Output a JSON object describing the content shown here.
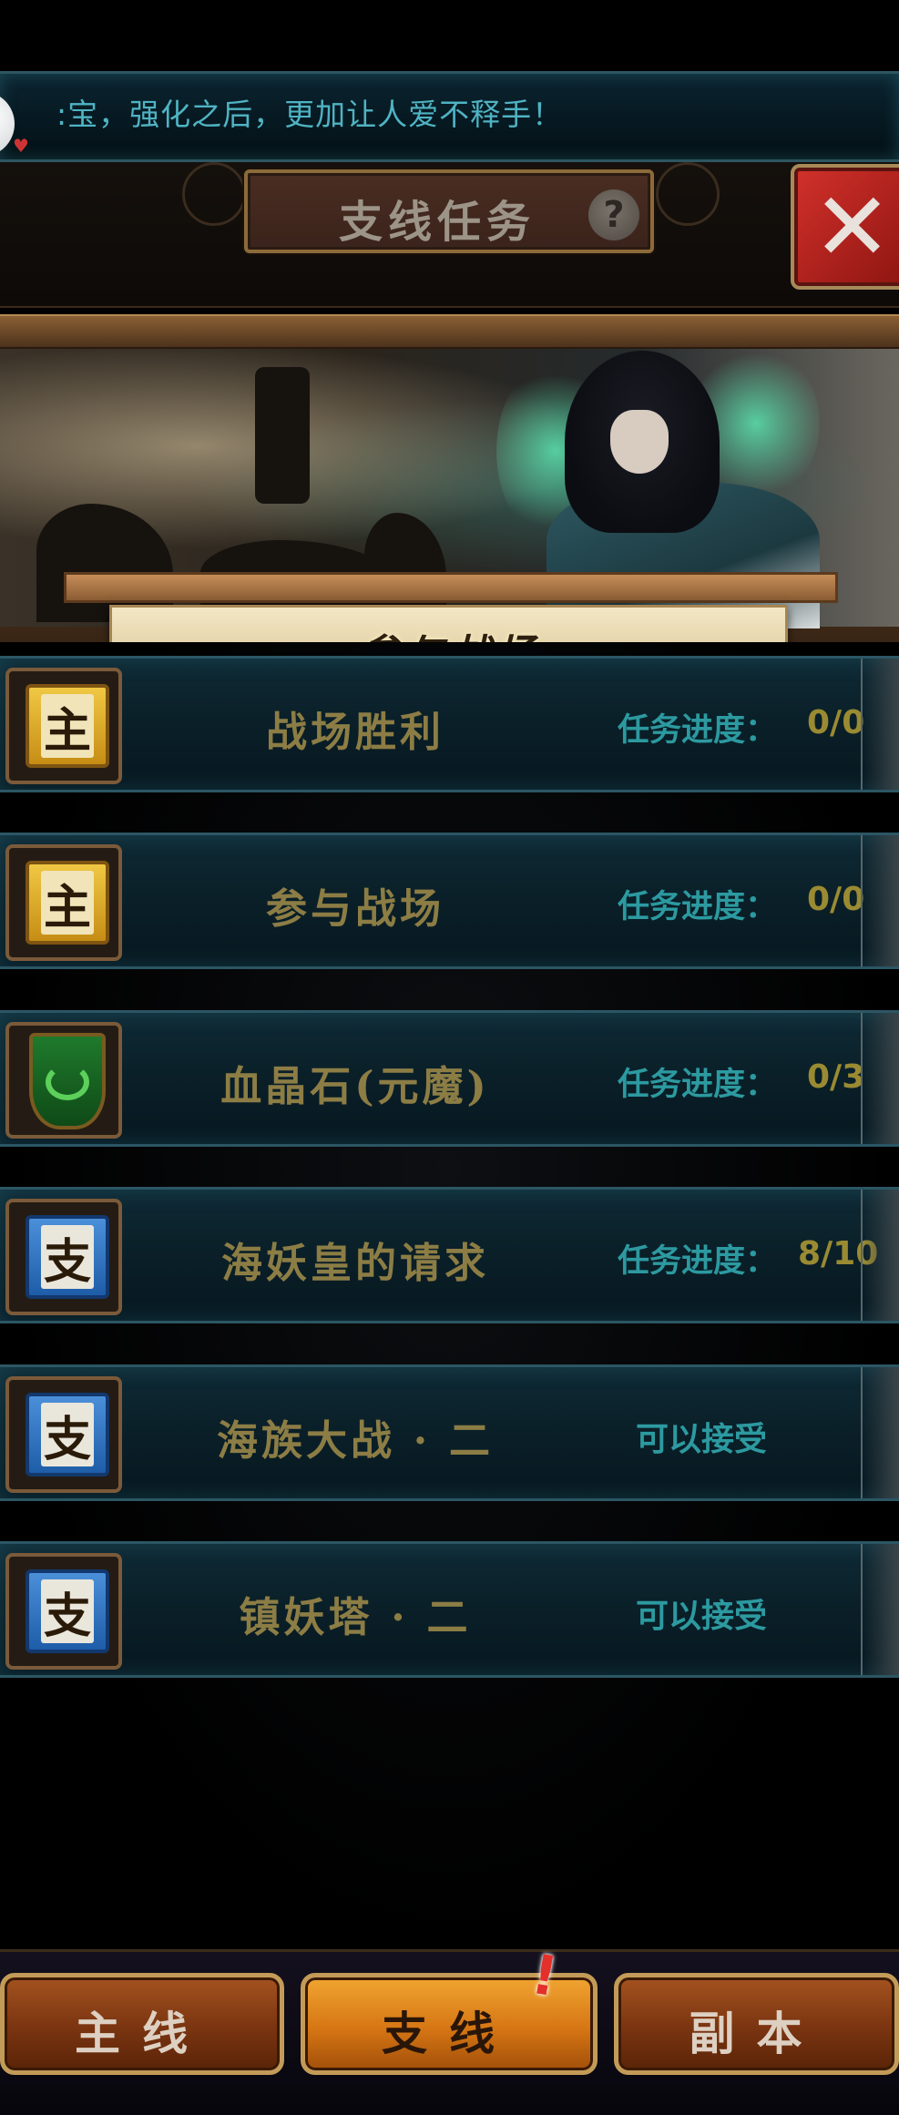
{
  "marquee": {
    "text": ":宝，强化之后，更加让人爱不释手！"
  },
  "header": {
    "title": "支线任务",
    "help": "?"
  },
  "banner": {
    "ribbon_label": "参与战场"
  },
  "quests": [
    {
      "name": "战场胜利",
      "icon": "scroll-gold-icon",
      "glyph": "主",
      "status_label": "任务进度：",
      "progress": "0/0"
    },
    {
      "name": "参与战场",
      "icon": "scroll-gold-icon",
      "glyph": "主",
      "status_label": "任务进度：",
      "progress": "0/0"
    },
    {
      "name": "血晶石(元魔)",
      "icon": "green-banner-icon",
      "glyph": "",
      "status_label": "任务进度：",
      "progress": "0/3"
    },
    {
      "name": "海妖皇的请求",
      "icon": "scroll-blue-icon",
      "glyph": "支",
      "status_label": "任务进度：",
      "progress": "8/10"
    },
    {
      "name": "海族大战 · 二",
      "icon": "scroll-blue-icon",
      "glyph": "支",
      "status_label": "可以接受",
      "progress": ""
    },
    {
      "name": "镇妖塔 · 二",
      "icon": "scroll-blue-icon",
      "glyph": "支",
      "status_label": "可以接受",
      "progress": ""
    }
  ],
  "tabs": [
    {
      "label": "主线",
      "active": false
    },
    {
      "label": "支线",
      "active": true
    },
    {
      "label": "副本",
      "active": false
    }
  ],
  "alert": "!"
}
